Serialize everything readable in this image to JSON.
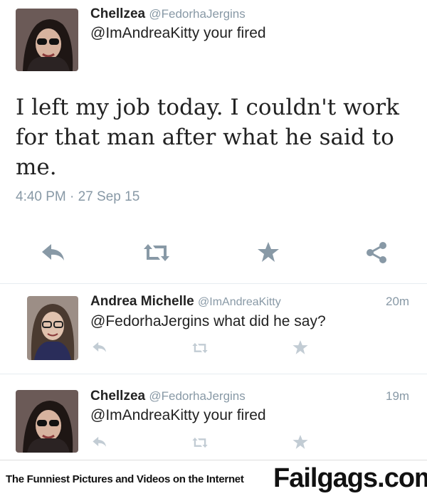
{
  "main_tweet": {
    "author_name": "Chellzea",
    "author_handle": "@FedorhaJergins",
    "reply_to": "@ImAndreaKitty your fired",
    "text": "I left my job today. I couldn't work for that man after what he said to me.",
    "timestamp": "4:40 PM · 27 Sep 15",
    "actions": [
      "reply-icon",
      "retweet-icon",
      "star-icon",
      "share-icon"
    ]
  },
  "replies": [
    {
      "author_name": "Andrea Michelle",
      "author_handle": "@ImAndreaKitty",
      "time": "20m",
      "text": "@FedorhaJergins what did he say?"
    },
    {
      "author_name": "Chellzea",
      "author_handle": "@FedorhaJergins",
      "time": "19m",
      "text": "@ImAndreaKitty your fired"
    }
  ],
  "footer": {
    "tagline": "The Funniest Pictures and Videos on the Internet",
    "brand": "Failgags.com"
  },
  "colors": {
    "muted": "#8899a6",
    "icon": "#8899a6",
    "divider": "#e6ecf0"
  }
}
